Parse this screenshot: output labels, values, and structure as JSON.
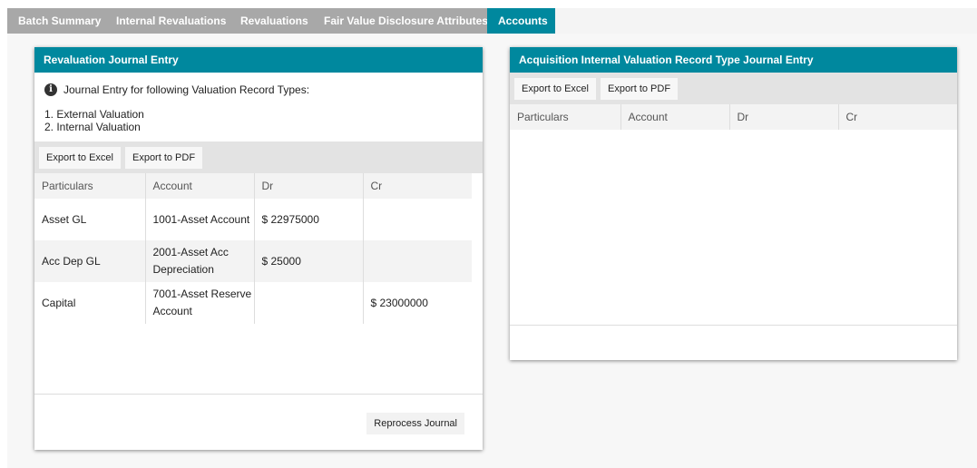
{
  "tabs": [
    "Batch Summary",
    "Internal Revaluations",
    "Revaluations",
    "Fair Value Disclosure Attributes",
    "Accounts"
  ],
  "active_tab": "Accounts",
  "left_panel": {
    "title": "Revaluation Journal Entry",
    "info_text": "Journal Entry for following Valuation Record Types:",
    "record_types": [
      "1. External Valuation",
      "2. Internal Valuation"
    ],
    "export_excel": "Export to Excel",
    "export_pdf": "Export to PDF",
    "columns": [
      "Particulars",
      "Account",
      "Dr",
      "Cr"
    ],
    "rows": [
      {
        "particulars": "Asset GL",
        "account": "1001-Asset Account",
        "dr": "$ 22975000",
        "cr": ""
      },
      {
        "particulars": "Acc Dep GL",
        "account": "2001-Asset Acc Depreciation",
        "dr": "$ 25000",
        "cr": ""
      },
      {
        "particulars": "Capital",
        "account": "7001-Asset Reserve Account",
        "dr": "",
        "cr": "$ 23000000"
      }
    ],
    "reprocess_label": "Reprocess Journal"
  },
  "right_panel": {
    "title": "Acquisition Internal Valuation Record Type Journal Entry",
    "export_excel": "Export to Excel",
    "export_pdf": "Export to PDF",
    "columns": [
      "Particulars",
      "Account",
      "Dr",
      "Cr"
    ]
  },
  "colors": {
    "accent": "#00889e",
    "tab_inactive": "#a8a8a8",
    "toolbar": "#e3e3e3"
  }
}
